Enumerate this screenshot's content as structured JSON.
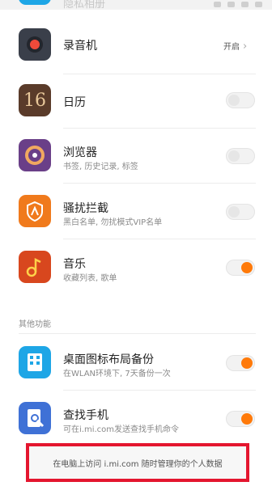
{
  "top_partial": {
    "label": "隐私相册"
  },
  "recorder": {
    "title": "录音机",
    "action_label": "开启",
    "chevron": "›"
  },
  "calendar": {
    "title": "日历",
    "icon_text": "16",
    "toggle_on": false
  },
  "browser": {
    "title": "浏览器",
    "subtitle": "书签, 历史记录, 标签",
    "toggle_on": false
  },
  "blocker": {
    "title": "骚扰拦截",
    "subtitle": "黑白名单, 勿扰模式VIP名单",
    "toggle_on": false
  },
  "music": {
    "title": "音乐",
    "subtitle": "收藏列表, 歌单",
    "toggle_on": true
  },
  "section": {
    "other_features": "其他功能"
  },
  "desktop_backup": {
    "title": "桌面图标布局备份",
    "subtitle": "在WLAN环境下, 7天备份一次",
    "toggle_on": true
  },
  "find_phone": {
    "title": "查找手机",
    "subtitle": "可在i.mi.com发送查找手机命令",
    "toggle_on": true
  },
  "footer": {
    "text": "在电脑上访问 i.mi.com 随时管理你的个人数据"
  },
  "colors": {
    "accent_orange": "#ff7a0a",
    "highlight_red": "#e4162f",
    "recorder_icon": "#3a3f4a",
    "calendar_icon": "#5a3b2a",
    "browser_icon": "#6a3f88",
    "blocker_icon": "#f07a1c",
    "music_icon": "#d8471e",
    "backup_icon": "#1ea6e6",
    "findphone_icon": "#3f71d6"
  }
}
